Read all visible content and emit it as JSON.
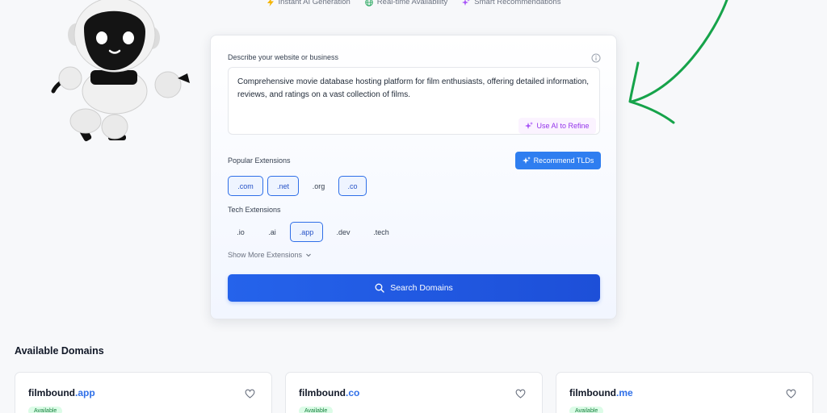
{
  "features": [
    {
      "label": "Instant AI Generation",
      "icon": "lightning-icon"
    },
    {
      "label": "Real-time Availability",
      "icon": "globe-icon"
    },
    {
      "label": "Smart Recommendations",
      "icon": "sparkle-icon"
    }
  ],
  "form": {
    "description_label": "Describe your website or business",
    "description_value": "Comprehensive movie database hosting platform for film enthusiasts, offering detailed information, reviews, and ratings on a vast collection of films.",
    "refine_label": "Use AI to Refine",
    "popular_label": "Popular Extensions",
    "recommend_label": "Recommend TLDs",
    "popular_extensions": [
      {
        "label": ".com",
        "selected": true
      },
      {
        "label": ".net",
        "selected": true
      },
      {
        "label": ".org",
        "selected": false
      },
      {
        "label": ".co",
        "selected": true
      }
    ],
    "tech_label": "Tech Extensions",
    "tech_extensions": [
      {
        "label": ".io",
        "selected": false
      },
      {
        "label": ".ai",
        "selected": false
      },
      {
        "label": ".app",
        "selected": true
      },
      {
        "label": ".dev",
        "selected": false
      },
      {
        "label": ".tech",
        "selected": false
      }
    ],
    "show_more_label": "Show More Extensions",
    "search_label": "Search Domains"
  },
  "results": {
    "title": "Available Domains",
    "domains": [
      {
        "name": "filmbound",
        "tld": ".app",
        "status": "Available"
      },
      {
        "name": "filmbound",
        "tld": ".co",
        "status": "Available"
      },
      {
        "name": "filmbound",
        "tld": ".me",
        "status": "Available"
      }
    ]
  },
  "colors": {
    "accent": "#2563eb",
    "refine": "#9333ea",
    "available": "#15803d",
    "arrow": "#16a34a"
  }
}
